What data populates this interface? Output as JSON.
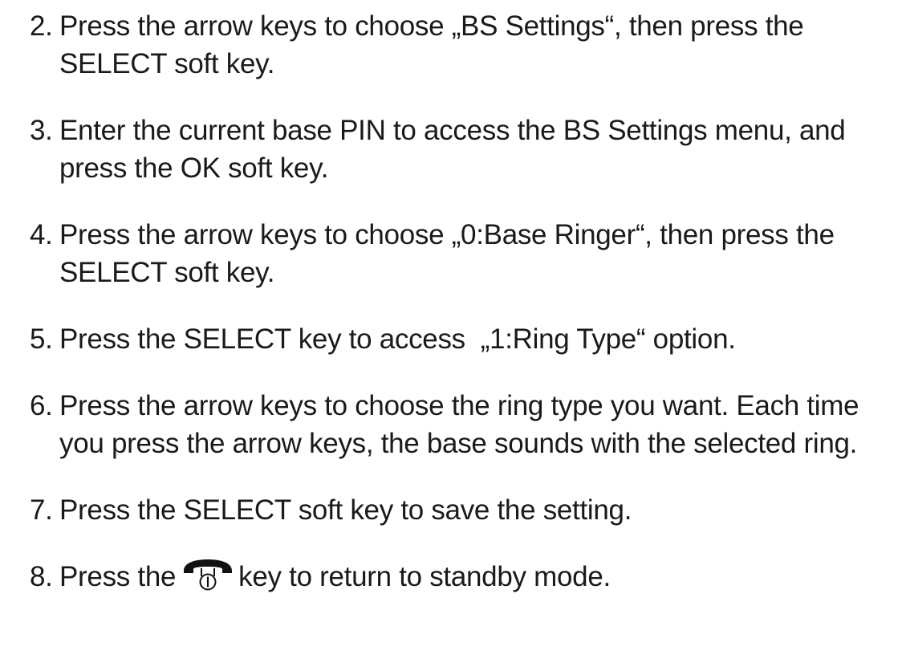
{
  "steps": [
    {
      "num": "2.",
      "text": "Press the arrow keys to choose „BS Settings“, then press the SELECT soft key."
    },
    {
      "num": "3.",
      "text": "Enter the current base PIN to access the BS Settings menu, and press the OK soft key."
    },
    {
      "num": "4.",
      "text": "Press the arrow keys to choose „0:Base Ringer“, then press the SELECT soft key."
    },
    {
      "num": "5.",
      "text": "Press the SELECT key to access  „1:Ring Type“ option."
    },
    {
      "num": "6.",
      "text": "Press the arrow keys to choose the ring type you want. Each time you press the arrow keys, the base sounds with the selected ring."
    },
    {
      "num": "7.",
      "text": "Press the SELECT soft key to save the setting."
    },
    {
      "num": "8.",
      "text_before": "Press the",
      "icon": "end-call-handset-icon",
      "text_after": "key to return to standby mode."
    }
  ]
}
